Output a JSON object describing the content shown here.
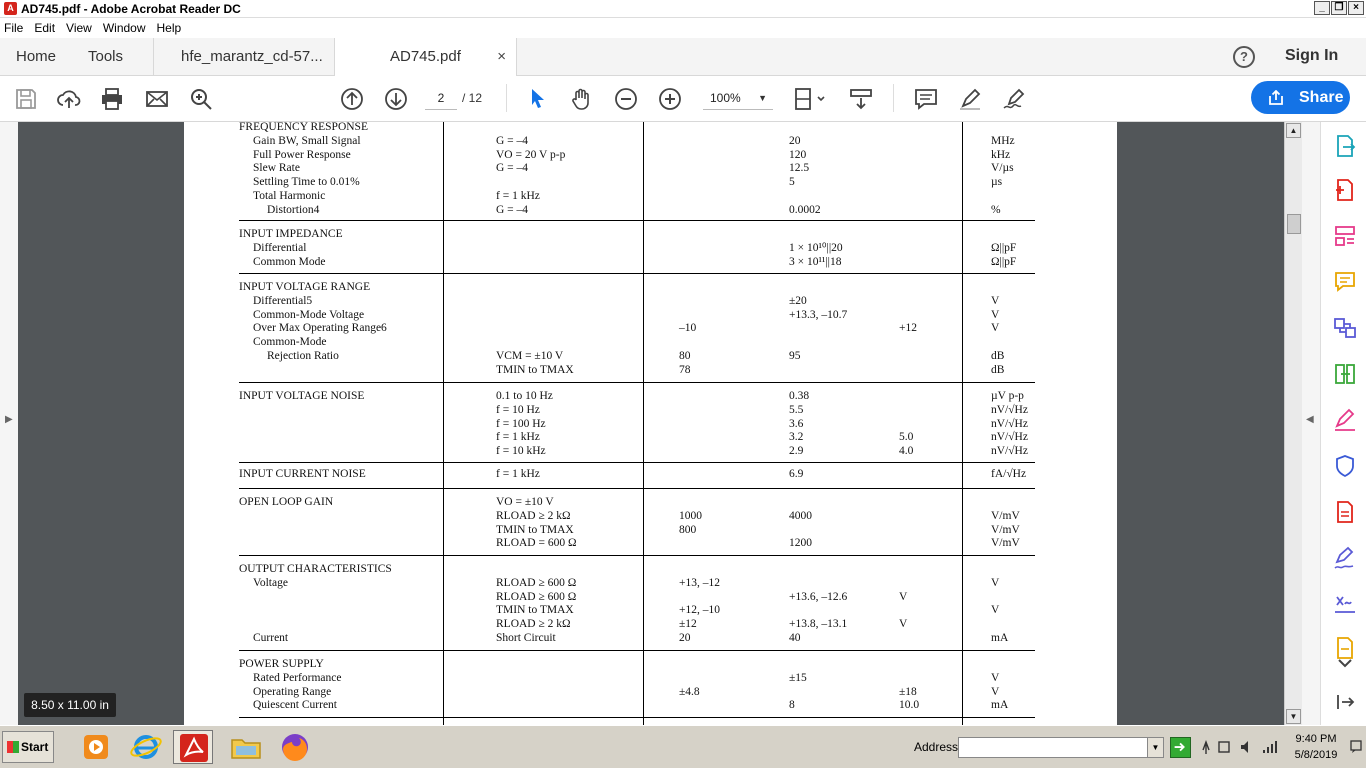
{
  "window": {
    "title": "AD745.pdf - Adobe Acrobat Reader DC",
    "app_icon_letter": "A",
    "controls": [
      "_",
      "❐",
      "×"
    ]
  },
  "menu": [
    "File",
    "Edit",
    "View",
    "Window",
    "Help"
  ],
  "tabs": {
    "home": "Home",
    "tools": "Tools",
    "doc1": "hfe_marantz_cd-57...",
    "doc2": "AD745.pdf",
    "close_glyph": "×"
  },
  "header": {
    "help": "?",
    "sign_in": "Sign In"
  },
  "toolbar": {
    "current_page": "2",
    "total_pages": "/ 12",
    "zoom": "100%",
    "zoom_arrow": "▼",
    "share_label": "Share",
    "accent": "#1473e6"
  },
  "viewer": {
    "page_size_badge": "8.50 x 11.00 in",
    "left_arrow": "▶",
    "right_arrow": "◀"
  },
  "datasheet": {
    "sections": [
      {
        "title": "FREQUENCY RESPONSE",
        "rows": [
          {
            "param": "Gain BW, Small Signal",
            "cond": "G = –4",
            "min": "",
            "typ": "20",
            "max": "",
            "unit": "MHz"
          },
          {
            "param": "Full Power Response",
            "cond": "VO = 20 V p-p",
            "min": "",
            "typ": "120",
            "max": "",
            "unit": "kHz"
          },
          {
            "param": "Slew Rate",
            "cond": "G = –4",
            "min": "",
            "typ": "12.5",
            "max": "",
            "unit": "V/µs"
          },
          {
            "param": "Settling Time to 0.01%",
            "cond": "",
            "min": "",
            "typ": "5",
            "max": "",
            "unit": "µs"
          },
          {
            "param": "Total Harmonic",
            "cond": "f = 1 kHz",
            "min": "",
            "typ": "",
            "max": "",
            "unit": ""
          },
          {
            "param": "Distortion4",
            "cond": "G = –4",
            "min": "",
            "typ": "0.0002",
            "max": "",
            "unit": "%",
            "indent": true
          }
        ]
      },
      {
        "title": "INPUT IMPEDANCE",
        "rows": [
          {
            "param": "Differential",
            "cond": "",
            "min": "",
            "typ": "1 × 10¹⁰||20",
            "max": "",
            "unit": "Ω||pF"
          },
          {
            "param": "Common Mode",
            "cond": "",
            "min": "",
            "typ": "3 × 10¹¹||18",
            "max": "",
            "unit": "Ω||pF"
          }
        ]
      },
      {
        "title": "INPUT VOLTAGE RANGE",
        "rows": [
          {
            "param": "Differential5",
            "cond": "",
            "min": "",
            "typ": "±20",
            "max": "",
            "unit": "V"
          },
          {
            "param": "Common-Mode Voltage",
            "cond": "",
            "min": "",
            "typ": "+13.3, –10.7",
            "max": "",
            "unit": "V"
          },
          {
            "param": "Over Max Operating Range6",
            "cond": "",
            "min": "–10",
            "typ": "",
            "max": "+12",
            "unit": "V"
          },
          {
            "param": "Common-Mode",
            "cond": "",
            "min": "",
            "typ": "",
            "max": "",
            "unit": ""
          },
          {
            "param": "Rejection Ratio",
            "cond": "VCM = ±10 V",
            "min": "80",
            "typ": "95",
            "max": "",
            "unit": "dB",
            "indent": true
          },
          {
            "param": "",
            "cond": "TMIN to TMAX",
            "min": "78",
            "typ": "",
            "max": "",
            "unit": "dB"
          }
        ]
      },
      {
        "title": "INPUT VOLTAGE NOISE",
        "rows": [
          {
            "param": "",
            "cond": "0.1 to 10 Hz",
            "min": "",
            "typ": "0.38",
            "max": "",
            "unit": "µV p-p",
            "first": true
          },
          {
            "param": "",
            "cond": "f = 10 Hz",
            "min": "",
            "typ": "5.5",
            "max": "",
            "unit": "nV/√Hz"
          },
          {
            "param": "",
            "cond": "f = 100 Hz",
            "min": "",
            "typ": "3.6",
            "max": "",
            "unit": "nV/√Hz"
          },
          {
            "param": "",
            "cond": "f = 1 kHz",
            "min": "",
            "typ": "3.2",
            "max": "5.0",
            "unit": "nV/√Hz"
          },
          {
            "param": "",
            "cond": "f = 10 kHz",
            "min": "",
            "typ": "2.9",
            "max": "4.0",
            "unit": "nV/√Hz"
          }
        ]
      },
      {
        "title": "INPUT CURRENT NOISE",
        "rows": [
          {
            "param": "",
            "cond": "f = 1 kHz",
            "min": "",
            "typ": "6.9",
            "max": "",
            "unit": "fA/√Hz",
            "first": true
          }
        ]
      },
      {
        "title": "OPEN LOOP GAIN",
        "rows": [
          {
            "param": "",
            "cond": "VO = ±10 V",
            "min": "",
            "typ": "",
            "max": "",
            "unit": "",
            "first": true
          },
          {
            "param": "",
            "cond": "RLOAD ≥ 2 kΩ",
            "min": "1000",
            "typ": "4000",
            "max": "",
            "unit": "V/mV"
          },
          {
            "param": "",
            "cond": "TMIN to TMAX",
            "min": "800",
            "typ": "",
            "max": "",
            "unit": "V/mV"
          },
          {
            "param": "",
            "cond": "RLOAD = 600 Ω",
            "min": "",
            "typ": "1200",
            "max": "",
            "unit": "V/mV"
          }
        ]
      },
      {
        "title": "OUTPUT CHARACTERISTICS",
        "rows": [
          {
            "param": "Voltage",
            "cond": "RLOAD ≥ 600 Ω",
            "min": "+13, –12",
            "typ": "",
            "max": "",
            "unit": "V"
          },
          {
            "param": "",
            "cond": "RLOAD ≥ 600 Ω",
            "min": "",
            "typ": "+13.6, –12.6",
            "max": "V",
            "unit": ""
          },
          {
            "param": "",
            "cond": "TMIN to TMAX",
            "min": "+12, –10",
            "typ": "",
            "max": "",
            "unit": "V"
          },
          {
            "param": "",
            "cond": "RLOAD ≥ 2 kΩ",
            "min": "±12",
            "typ": "+13.8, –13.1",
            "max": "V",
            "unit": ""
          },
          {
            "param": "Current",
            "cond": "Short Circuit",
            "min": "20",
            "typ": "40",
            "max": "",
            "unit": "mA"
          }
        ]
      },
      {
        "title": "POWER SUPPLY",
        "rows": [
          {
            "param": "Rated Performance",
            "cond": "",
            "min": "",
            "typ": "±15",
            "max": "",
            "unit": "V"
          },
          {
            "param": "Operating Range",
            "cond": "",
            "min": "±4.8",
            "typ": "",
            "max": "±18",
            "unit": "V"
          },
          {
            "param": "Quiescent Current",
            "cond": "",
            "min": "",
            "typ": "8",
            "max": "10.0",
            "unit": "mA"
          }
        ]
      }
    ]
  },
  "taskbar": {
    "start": "Start",
    "address_label": "Address",
    "address_value": "",
    "time": "9:40 PM",
    "date": "5/8/2019"
  }
}
